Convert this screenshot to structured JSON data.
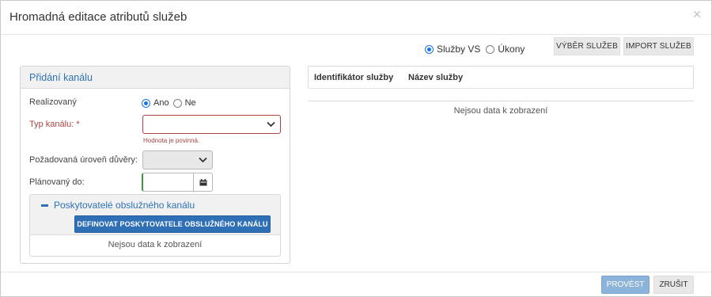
{
  "dialog": {
    "title": "Hromadná editace atributů služeb",
    "close_icon": "close-icon"
  },
  "scope": {
    "option_vs": "Služby VS",
    "option_ukony": "Úkony",
    "selected": "Služby VS"
  },
  "toolbar": {
    "select_services": "VÝBĚR SLUŽEB",
    "import_services": "IMPORT SLUŽEB"
  },
  "channel_panel": {
    "title": "Přidání kanálu",
    "realized_label": "Realizovaný",
    "realized_yes": "Ano",
    "realized_no": "Ne",
    "realized_selected": "Ano",
    "channel_type_label": "Typ kanálu: *",
    "channel_type_value": "",
    "channel_type_error": "Hodnota je povinná.",
    "trust_level_label": "Požadovaná úroveň důvěry:",
    "trust_level_value": "",
    "planned_label": "Plánovaný do:",
    "planned_value": "",
    "calendar_icon": "calendar-icon"
  },
  "providers": {
    "title": "Poskytovatelé obslužného kanálu",
    "define_button": "DEFINOVAT POSKYTOVATELE OBSLUŽNÉHO KANÁLU",
    "empty": "Nejsou data k zobrazení"
  },
  "services_grid": {
    "columns": [
      "Identifikátor služby",
      "Název služby"
    ],
    "rows": [],
    "empty": "Nejsou data k zobrazení"
  },
  "footer": {
    "confirm": "PROVÉST",
    "cancel": "ZRUŠIT"
  },
  "colors": {
    "accent": "#2e72b8",
    "error": "#a94442",
    "valid": "#3c9a3c"
  }
}
